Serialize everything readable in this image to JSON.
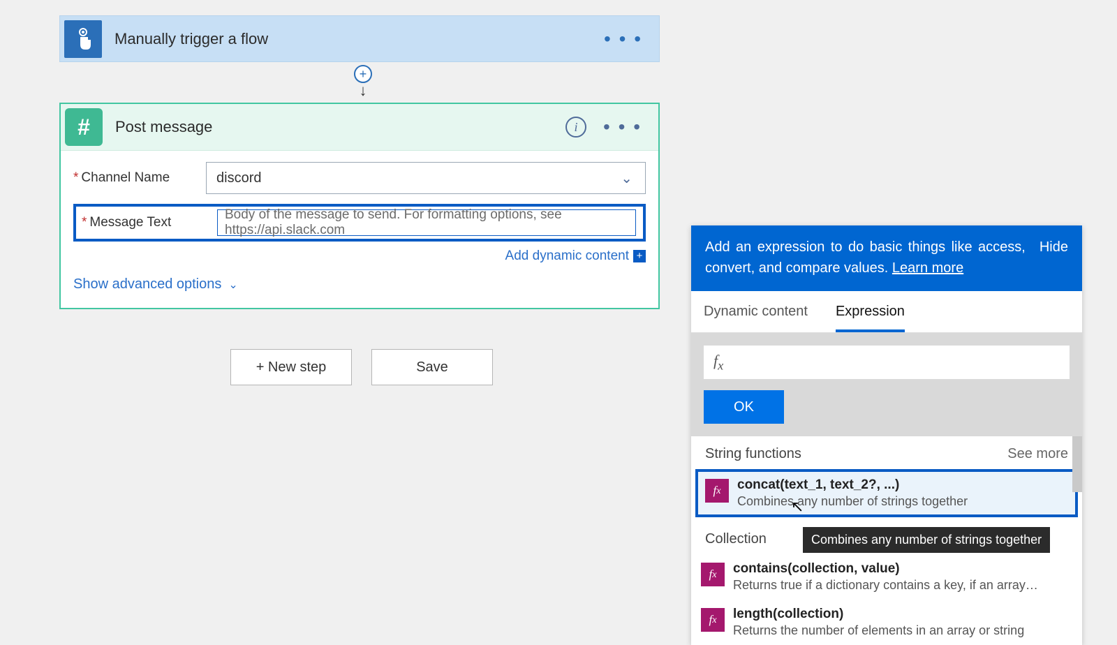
{
  "trigger": {
    "title": "Manually trigger a flow"
  },
  "action": {
    "title": "Post message",
    "fields": {
      "channel_label": "Channel Name",
      "channel_value": "discord",
      "message_label": "Message Text",
      "message_placeholder": "Body of the message to send. For formatting options, see https://api.slack.com"
    },
    "add_dynamic": "Add dynamic content",
    "show_advanced": "Show advanced options"
  },
  "buttons": {
    "new_step": "+ New step",
    "save": "Save"
  },
  "panel": {
    "intro": "Add an expression to do basic things like access, convert, and compare values. ",
    "learn_more": "Learn more",
    "hide": "Hide",
    "tabs": {
      "dynamic": "Dynamic content",
      "expression": "Expression"
    },
    "ok": "OK",
    "categories": [
      {
        "name": "String functions",
        "see_more": "See more",
        "items": [
          {
            "sig": "concat(text_1, text_2?, ...)",
            "desc": "Combines any number of strings together"
          }
        ]
      },
      {
        "name": "Collection",
        "see_more": "",
        "items": [
          {
            "sig": "contains(collection, value)",
            "desc": "Returns true if a dictionary contains a key, if an array cont..."
          },
          {
            "sig": "length(collection)",
            "desc": "Returns the number of elements in an array or string"
          }
        ]
      }
    ],
    "tooltip": "Combines any number of strings together"
  }
}
